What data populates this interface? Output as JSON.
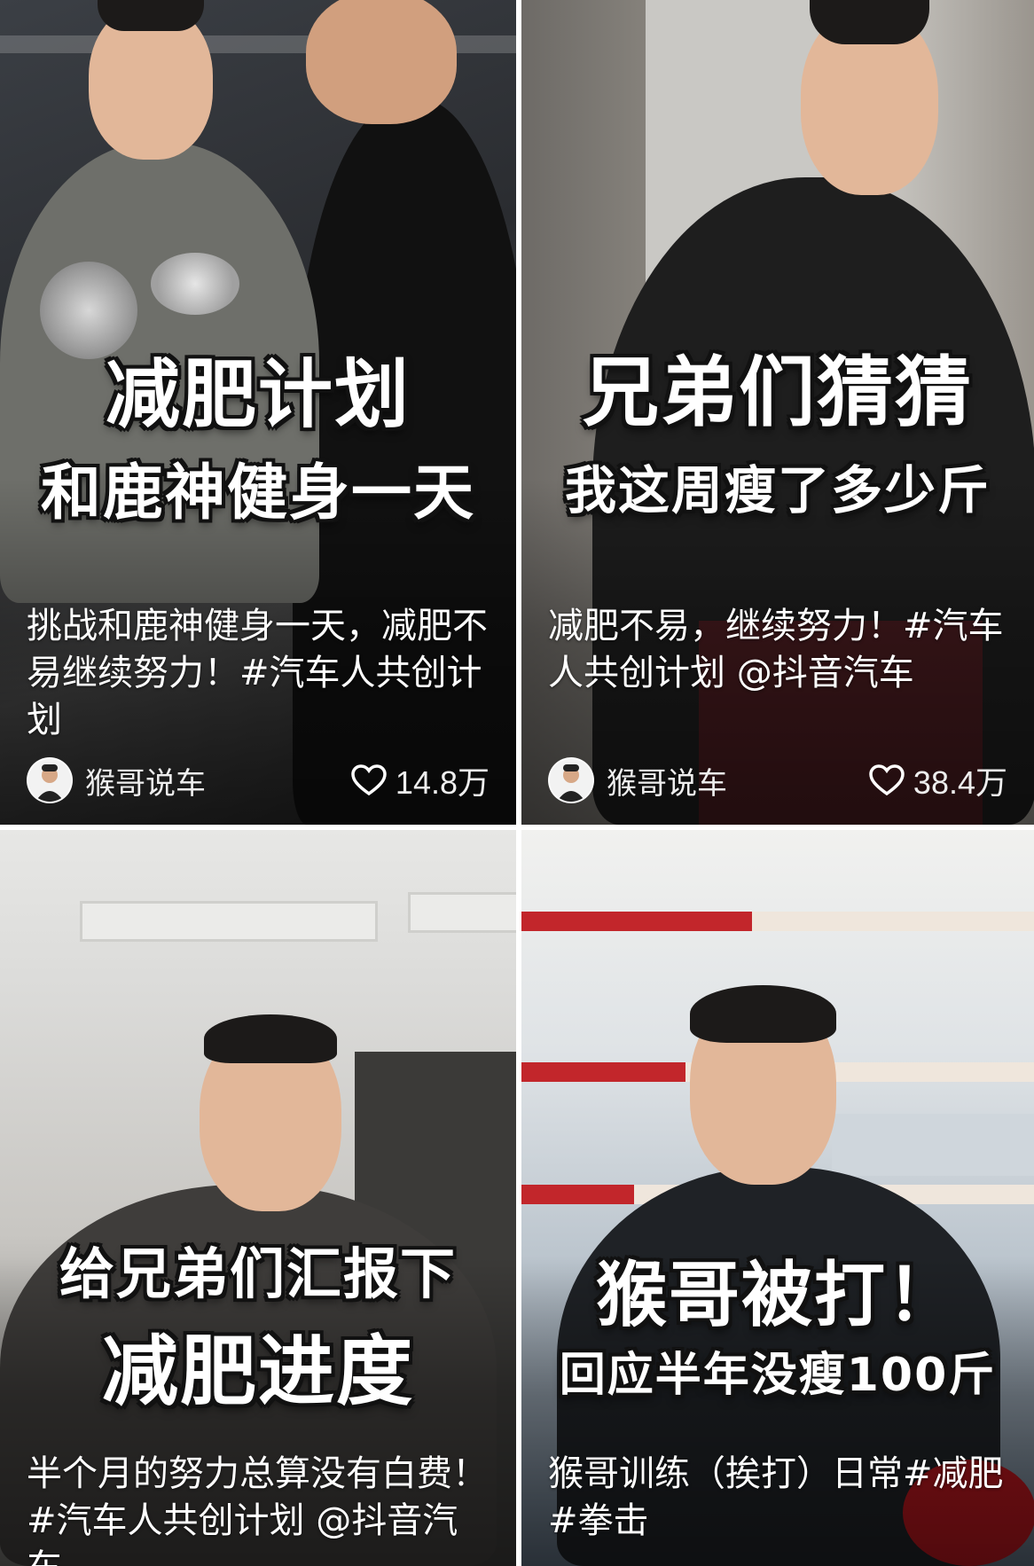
{
  "cards": [
    {
      "overlay_line1": "减肥计划",
      "overlay_line2": "和鹿神健身一天",
      "description": "挑战和鹿神健身一天，减肥不易继续努力！#汽车人共创计划",
      "author": "猴哥说车",
      "likes": "14.8万"
    },
    {
      "overlay_line1": "兄弟们猜猜",
      "overlay_line2": "我这周瘦了多少斤",
      "description": "减肥不易，继续努力！#汽车人共创计划 @抖音汽车",
      "author": "猴哥说车",
      "likes": "38.4万"
    },
    {
      "overlay_line1": "给兄弟们汇报下",
      "overlay_line2": "减肥进度",
      "description": "半个月的努力总算没有白费！#汽车人共创计划 @抖音汽车"
    },
    {
      "overlay_line1": "猴哥被打！",
      "overlay_line2": "回应半年没瘦100斤",
      "description": "猴哥训练（挨打）日常#减肥 #拳击"
    }
  ]
}
